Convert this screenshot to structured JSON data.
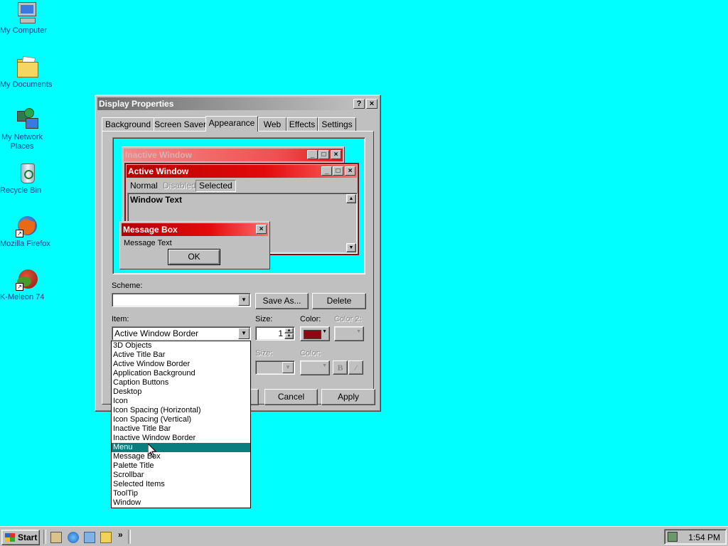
{
  "desktop": {
    "icons": [
      {
        "label": "My Computer",
        "icon": "computer-icon"
      },
      {
        "label": "My Documents",
        "icon": "folder-icon"
      },
      {
        "label": "My Network Places",
        "icon": "network-icon"
      },
      {
        "label": "Recycle Bin",
        "icon": "recycle-bin-icon"
      },
      {
        "label": "Mozilla Firefox",
        "icon": "firefox-icon"
      },
      {
        "label": "K-Meleon 74",
        "icon": "k-meleon-icon"
      }
    ]
  },
  "dialog": {
    "title": "Display Properties",
    "help_glyph": "?",
    "close_glyph": "×",
    "tabs": [
      {
        "label": "Background"
      },
      {
        "label": "Screen Saver"
      },
      {
        "label": "Appearance"
      },
      {
        "label": "Web"
      },
      {
        "label": "Effects"
      },
      {
        "label": "Settings"
      }
    ],
    "active_tab": "Appearance",
    "preview": {
      "inactive_title": "Inactive Window",
      "active_title": "Active Window",
      "menu": {
        "normal": "Normal",
        "disabled": "Disabled",
        "selected": "Selected"
      },
      "window_text": "Window Text",
      "message_box_title": "Message Box",
      "message_text": "Message Text",
      "ok_label": "OK"
    },
    "scheme": {
      "label": "Scheme:",
      "value": "",
      "save_as": "Save As...",
      "delete": "Delete"
    },
    "item": {
      "label": "Item:",
      "value": "Active Window Border"
    },
    "size": {
      "label": "Size:",
      "value": "1"
    },
    "color": {
      "label": "Color:",
      "swatch": "#8b0a14"
    },
    "color2": {
      "label": "Color 2:"
    },
    "font": {
      "size_label": "Size:",
      "color_label": "Color:",
      "bold": "B",
      "italic": "/"
    },
    "buttons": {
      "cancel": "Cancel",
      "apply": "Apply"
    }
  },
  "item_list": {
    "items": [
      "3D Objects",
      "Active Title Bar",
      "Active Window Border",
      "Application Background",
      "Caption Buttons",
      "Desktop",
      "Icon",
      "Icon Spacing (Horizontal)",
      "Icon Spacing (Vertical)",
      "Inactive Title Bar",
      "Inactive Window Border",
      "Menu",
      "Message Box",
      "Palette Title",
      "Scrollbar",
      "Selected Items",
      "ToolTip",
      "Window"
    ],
    "highlighted": "Menu",
    "highlight_color": "#0a7e7e"
  },
  "taskbar": {
    "start_label": "Start",
    "quick_launch": [
      "show-desktop-icon",
      "internet-explorer-icon",
      "outlook-express-icon",
      "windows-explorer-icon"
    ],
    "chevron": "»",
    "clock": "1:54 PM"
  },
  "colors": {
    "desktop": "#00ffff",
    "face": "#c0c0c0",
    "active_title": "#b50000"
  }
}
